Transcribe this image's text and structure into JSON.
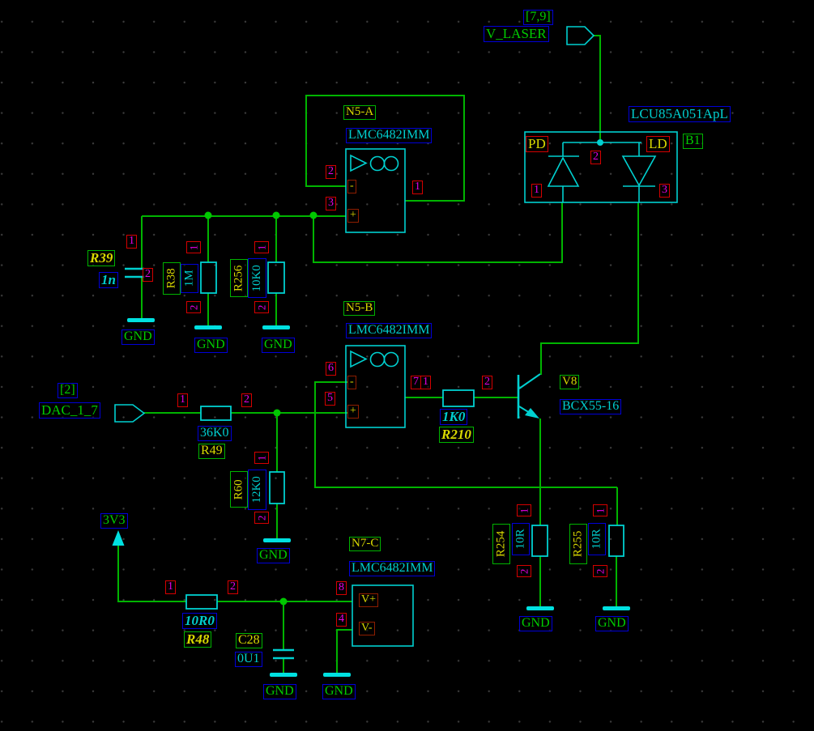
{
  "labels": {
    "gnd": "GND"
  },
  "pins": {
    "p1": "1",
    "p2": "2",
    "p3": "3",
    "p4": "4",
    "p5": "5",
    "p6": "6",
    "p7": "7",
    "p8": "8"
  },
  "markers": {
    "minus": "-",
    "plus": "+",
    "vplus": "V+",
    "vminus": "V-"
  },
  "ports": {
    "v_laser": {
      "name": "V_LASER",
      "sheet_ref": "[7,9]"
    },
    "dac": {
      "name": "DAC_1_7",
      "sheet_ref": "[2]"
    },
    "p3v3": {
      "name": "3V3"
    }
  },
  "components": {
    "b1": {
      "ref": "B1",
      "part": "LCU85A051ApL",
      "pd": "PD",
      "ld": "LD"
    },
    "n5a": {
      "ref": "N5-A",
      "part": "LMC6482IMM"
    },
    "n5b": {
      "ref": "N5-B",
      "part": "LMC6482IMM"
    },
    "n7c": {
      "ref": "N7-C",
      "part": "LMC6482IMM"
    },
    "r39": {
      "ref": "R39",
      "value": "1n"
    },
    "r38": {
      "ref": "R38",
      "value": "1M"
    },
    "r256": {
      "ref": "R256",
      "value": "10K0"
    },
    "r49": {
      "ref": "R49",
      "value": "36K0"
    },
    "r60": {
      "ref": "R60",
      "value": "12K0"
    },
    "r210": {
      "ref": "R210",
      "value": "1K0"
    },
    "r48": {
      "ref": "R48",
      "value": "10R0"
    },
    "c28": {
      "ref": "C28",
      "value": "0U1"
    },
    "v8": {
      "ref": "V8",
      "part": "BCX55-16"
    },
    "r254": {
      "ref": "R254",
      "value": "10R"
    },
    "r255": {
      "ref": "R255",
      "value": "10R"
    }
  },
  "palette": {
    "wire": "#00b400",
    "component_body": "#00d0d0",
    "gnd_bar": "#00e0e0",
    "designator_text": "#d9d900",
    "designator_box": "#00b400",
    "value_text": "#00cdcd",
    "value_box": "#0000d8",
    "net_text": "#00cc00",
    "net_box": "#0000d8",
    "pin_text": "#e800e8",
    "pin_box": "#d40000",
    "marker_box": "#8e1e00",
    "background": "#000000"
  }
}
